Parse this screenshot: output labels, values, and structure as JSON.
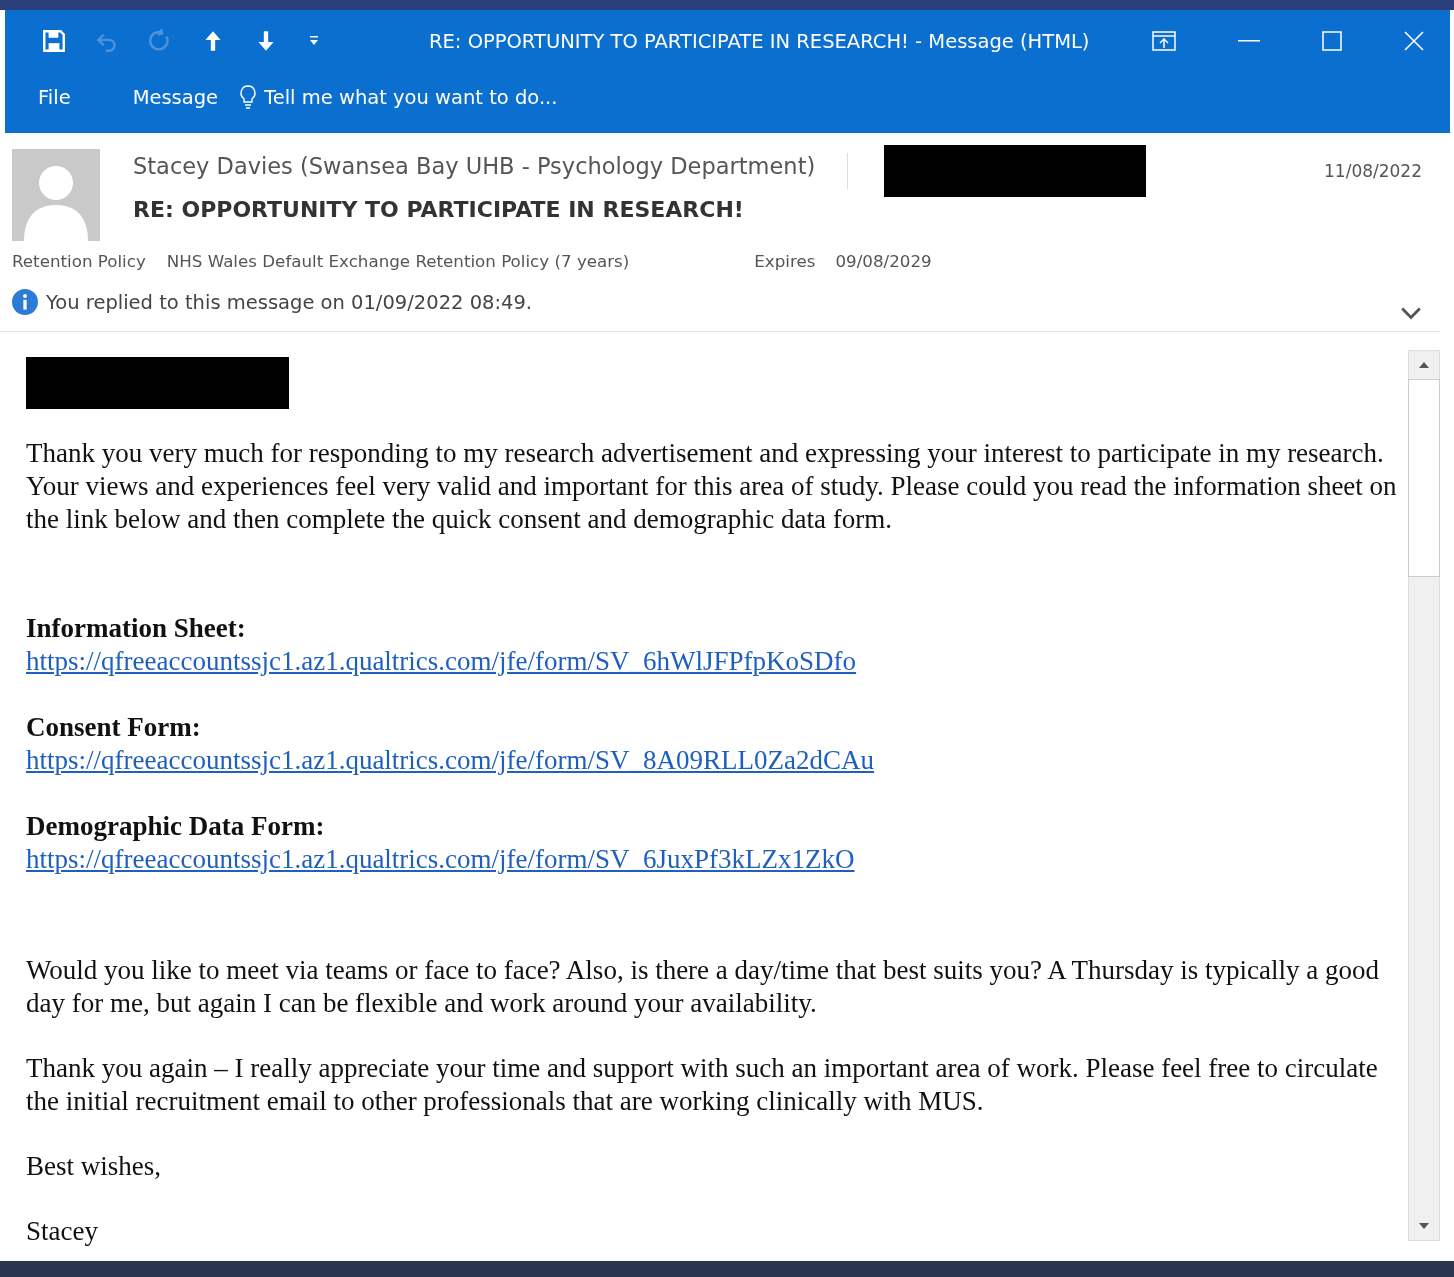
{
  "window": {
    "title": "RE: OPPORTUNITY TO PARTICIPATE IN RESEARCH! - Message (HTML)"
  },
  "ribbon_tabs": [
    {
      "label": "File"
    },
    {
      "label": "Message"
    }
  ],
  "tell_me": {
    "placeholder": "Tell me what you want to do..."
  },
  "header": {
    "sender": "Stacey Davies (Swansea Bay UHB - Psychology Department)",
    "subject": "RE: OPPORTUNITY TO PARTICIPATE IN RESEARCH!",
    "date": "11/08/2022",
    "retention_label": "Retention Policy",
    "retention_policy": "NHS Wales Default Exchange Retention Policy (7 years)",
    "expires_label": "Expires",
    "expires_date": "09/08/2029",
    "info": "You replied to this message on 01/09/2022 08:49."
  },
  "body": [
    {
      "kind": "paragraph",
      "text": "Thank you very much for responding to my research advertisement and expressing your interest to participate in my research. Your views and experiences feel very valid and important for this area of study. Please could you read the information sheet on the link below and then complete the quick consent and demographic data form."
    },
    {
      "kind": "link",
      "label": "Information Sheet:",
      "url": "https://qfreeaccountssjc1.az1.qualtrics.com/jfe/form/SV_6hWlJFPfpKoSDfo"
    },
    {
      "kind": "link",
      "label": "Consent Form:",
      "url": "https://qfreeaccountssjc1.az1.qualtrics.com/jfe/form/SV_8A09RLL0Za2dCAu"
    },
    {
      "kind": "link",
      "label": "Demographic Data Form:",
      "url": "https://qfreeaccountssjc1.az1.qualtrics.com/jfe/form/SV_6JuxPf3kLZx1ZkO"
    },
    {
      "kind": "paragraph",
      "text": "Would you like to meet via teams or face to face? Also, is there a day/time that best suits you? A Thursday is typically a good day for me, but again I can be flexible and work around your availability."
    },
    {
      "kind": "paragraph",
      "text": "Thank you again – I really appreciate your time and support with such an important area of work. Please feel free to circulate the initial recruitment email to other professionals that are working clinically with MUS."
    },
    {
      "kind": "paragraph",
      "text": "Best wishes,"
    },
    {
      "kind": "paragraph",
      "text": "Stacey"
    }
  ]
}
